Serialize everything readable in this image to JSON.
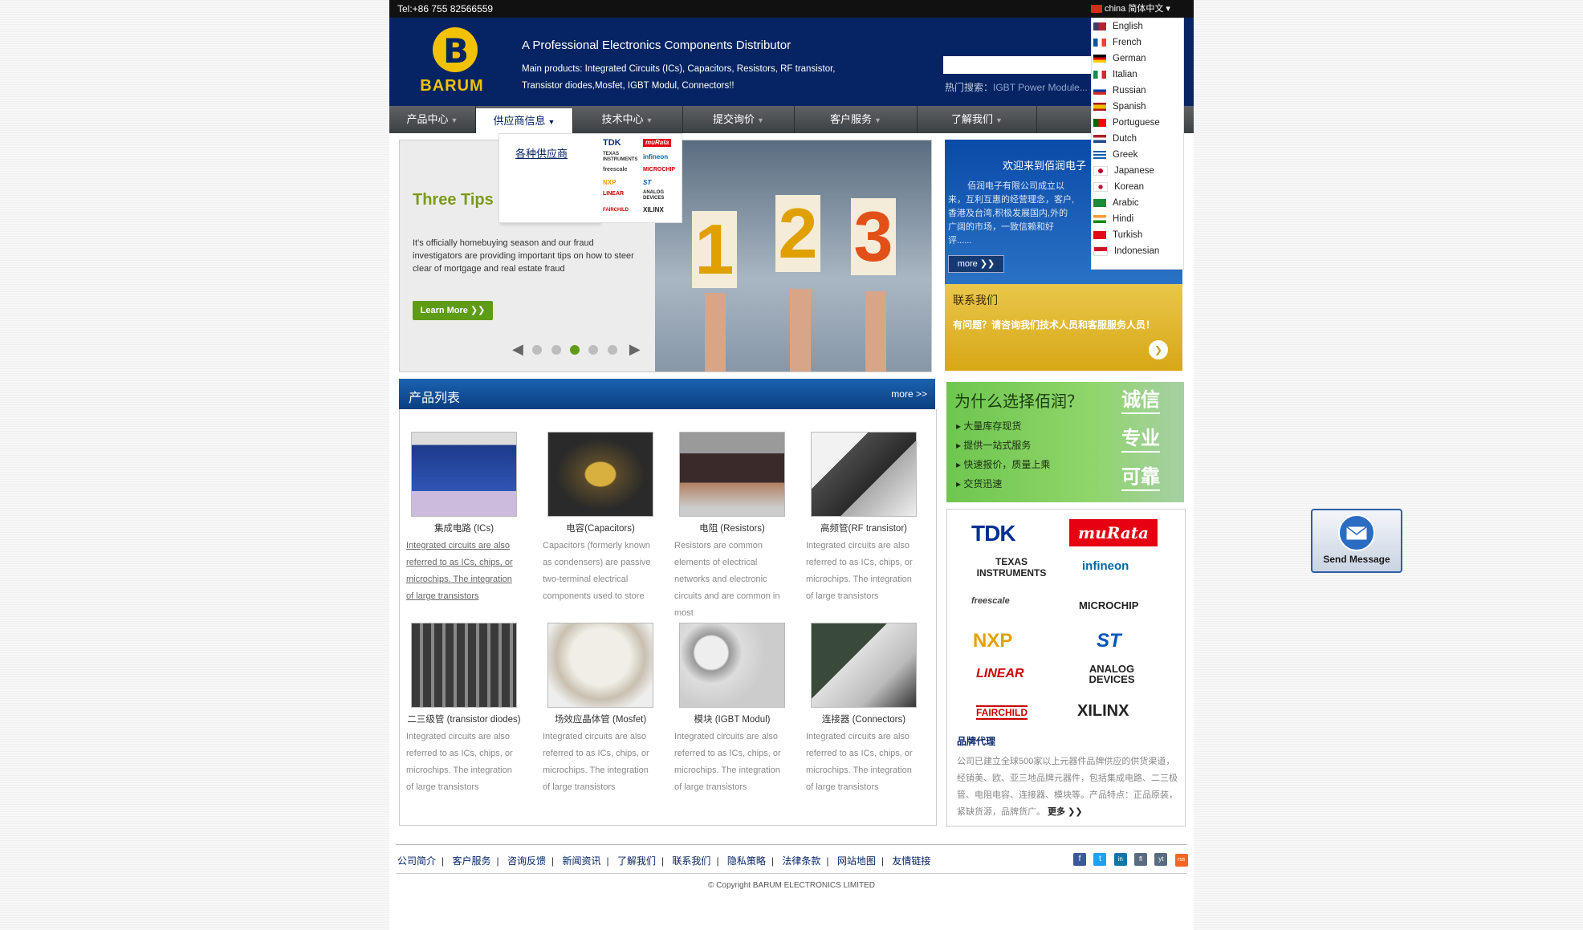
{
  "topbar": {
    "tel": "Tel:+86 755 82566559",
    "lang_current": "china 简体中文 ▾"
  },
  "header": {
    "logo_text": "BARUM",
    "tagline": "A Professional Electronics Components Distributor",
    "main_products": "Main products: Integrated Circuits (ICs), Capacitors, Resistors, RF transistor, Transistor diodes,Mosfet, IGBT Modul, Connectors!!",
    "hot_label": "热门搜索：",
    "hot_keyword": "IGBT Power Module..."
  },
  "nav": {
    "items": [
      {
        "label": "产品中心"
      },
      {
        "label": "供应商信息"
      },
      {
        "label": "技术中心"
      },
      {
        "label": "提交询价"
      },
      {
        "label": "客户服务"
      },
      {
        "label": "了解我们"
      }
    ],
    "dropdown_link": "各种供应商",
    "dropdown_logos": [
      "TDK",
      "muRata",
      "TEXAS INSTRUMENTS",
      "infineon",
      "freescale",
      "MICROCHIP",
      "NXP",
      "ST",
      "LINEAR",
      "ANALOG DEVICES",
      "FAIRCHILD",
      "XILINX"
    ]
  },
  "languages": [
    "English",
    "French",
    "German",
    "Italian",
    "Russian",
    "Spanish",
    "Portuguese",
    "Dutch",
    "Greek",
    "Japanese",
    "Korean",
    "Arabic",
    "Hindi",
    "Turkish",
    "Indonesian"
  ],
  "slider": {
    "heading": "Three Tips Newbies",
    "text": "It's officially homebuying season and our fraud investigators are providing important tips on how to steer clear of mortgage and real estate fraud",
    "button": "Learn More ❯❯",
    "digits": [
      "1",
      "2",
      "3"
    ],
    "active_slide": 3,
    "slide_count": 5
  },
  "welcome": {
    "title": "欢迎来到佰润电子",
    "text": "佰润电子有限公司成立以来，互利互惠的经营理念，客户,香港及台湾,积极发展国内,外的广阔的市场，一致信赖和好评......",
    "more": "more ❯❯"
  },
  "contact": {
    "title": "联系我们",
    "text": "有问题？请咨询我们技术人员和客服服务人员！",
    "go": "❯"
  },
  "products": {
    "title": "产品列表",
    "more": "more >>",
    "items": [
      {
        "name": "集成电路 (ICs)",
        "desc": "Integrated circuits are also referred to as ICs, chips, or microchips. The integration of large transistors"
      },
      {
        "name": "电容(Capacitors)",
        "desc": "Capacitors (formerly known as condensers) are passive two-terminal electrical components used to store"
      },
      {
        "name": "电阻 (Resistors)",
        "desc": "Resistors are common elements of electrical networks and electronic circuits and are common in most"
      },
      {
        "name": "高频管(RF transistor)",
        "desc": "Integrated circuits are also referred to as ICs, chips, or microchips. The integration of large transistors"
      },
      {
        "name": "二三级管 (transistor diodes)",
        "desc": "Integrated circuits are also referred to as ICs, chips, or microchips. The integration of large transistors"
      },
      {
        "name": "场效应晶体管 (Mosfet)",
        "desc": "Integrated circuits are also referred to as ICs, chips, or microchips. The integration of large transistors"
      },
      {
        "name": "模块 (IGBT Modul)",
        "desc": "Integrated circuits are also referred to as ICs, chips, or microchips. The integration of large transistors"
      },
      {
        "name": "连接器 (Connectors)",
        "desc": "Integrated circuits are also referred to as ICs, chips, or microchips. The integration of large transistors"
      }
    ]
  },
  "why": {
    "title": "为什么选择佰润？",
    "points": [
      "大量库存现货",
      "提供一站式服务",
      "快速报价，质量上乘",
      "交货迅速"
    ],
    "badges": [
      "诚信",
      "专业",
      "可靠"
    ]
  },
  "brands": {
    "logos": [
      "TDK",
      "muRata",
      "TEXAS INSTRUMENTS",
      "infineon",
      "freescale",
      "MICROCHIP",
      "NXP",
      "ST",
      "LINEAR",
      "ANALOG DEVICES",
      "FAIRCHILD",
      "XILINX"
    ],
    "title": "品牌代理",
    "text": "公司已建立全球500家以上元器件品牌供应的供货渠道，经销美、欧、亚三地品牌元器件，包括集成电路、二三极管、电阻电容、连接器、模块等。产品特点：正品原装，紧缺货源，品牌货广。",
    "more": "更多 ❯❯"
  },
  "send_message": "Send Message",
  "footer": {
    "links": [
      "公司简介",
      "客户服务",
      "咨询反馈",
      "新闻资讯",
      "了解我们",
      "联系我们",
      "隐私策略",
      "法律条款",
      "网站地图",
      "友情链接"
    ],
    "social": [
      "f",
      "t",
      "in",
      "fl",
      "yt",
      "rss"
    ],
    "copyright": "© Copyright BARUM ELECTRONICS LIMITED"
  }
}
